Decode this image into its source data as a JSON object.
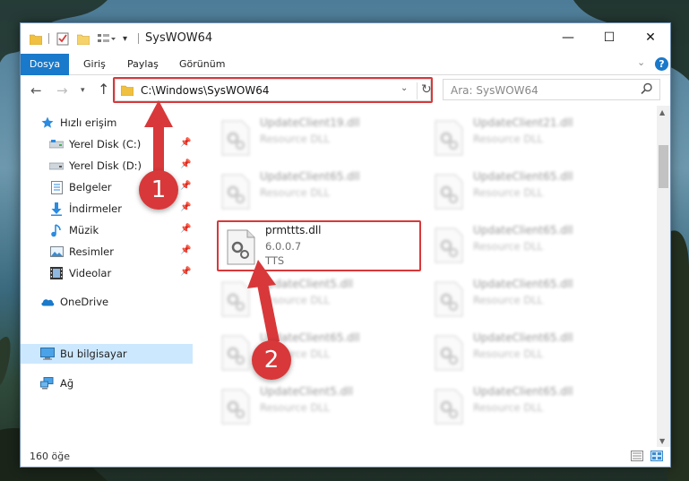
{
  "window": {
    "title": "SysWOW64",
    "controls": {
      "minimize": "—",
      "maximize": "☐",
      "close": "✕"
    }
  },
  "ribbon": {
    "tabs": [
      "Dosya",
      "Giriş",
      "Paylaş",
      "Görünüm"
    ],
    "help": "?"
  },
  "address": {
    "path": "C:\\Windows\\SysWOW64",
    "search_placeholder": "Ara: SysWOW64"
  },
  "sidebar": {
    "quick_access": "Hızlı erişim",
    "items": [
      {
        "label": "Yerel Disk (C:)",
        "pinned": true
      },
      {
        "label": "Yerel Disk (D:)",
        "pinned": true
      },
      {
        "label": "Belgeler",
        "pinned": true
      },
      {
        "label": "İndirmeler",
        "pinned": true
      },
      {
        "label": "Müzik",
        "pinned": true
      },
      {
        "label": "Resimler",
        "pinned": true
      },
      {
        "label": "Videolar",
        "pinned": true
      }
    ],
    "onedrive": "OneDrive",
    "this_pc": "Bu bilgisayar",
    "network": "Ağ"
  },
  "files": {
    "left_column": [
      {
        "name": "UpdateClient19.dll",
        "desc": "Resource DLL"
      },
      {
        "name": "UpdateClient65.dll",
        "desc": "Resource DLL"
      },
      {
        "name": "prmttts.dll",
        "version": "6.0.0.7",
        "desc": "TTS",
        "highlighted": true
      },
      {
        "name": "UpdateClient5.dll",
        "desc": "Resource DLL"
      },
      {
        "name": "UpdateClient65.dll",
        "desc": "Resource DLL"
      },
      {
        "name": "UpdateClient5.dll",
        "desc": "Resource DLL"
      }
    ],
    "right_column": [
      {
        "name": "UpdateClient21.dll",
        "desc": "Resource DLL"
      },
      {
        "name": "UpdateClient65.dll",
        "desc": "Resource DLL"
      },
      {
        "name": "UpdateClient65.dll",
        "desc": "Resource DLL"
      },
      {
        "name": "UpdateClient65.dll",
        "desc": "Resource DLL"
      },
      {
        "name": "UpdateClient65.dll",
        "desc": "Resource DLL"
      },
      {
        "name": "UpdateClient65.dll",
        "desc": "Resource DLL"
      }
    ]
  },
  "status": {
    "item_count": "160 öğe"
  },
  "annotations": {
    "step1": "1",
    "step2": "2"
  },
  "colors": {
    "accent": "#1979ca",
    "highlight": "#d8383a",
    "selection": "#cce8ff"
  }
}
